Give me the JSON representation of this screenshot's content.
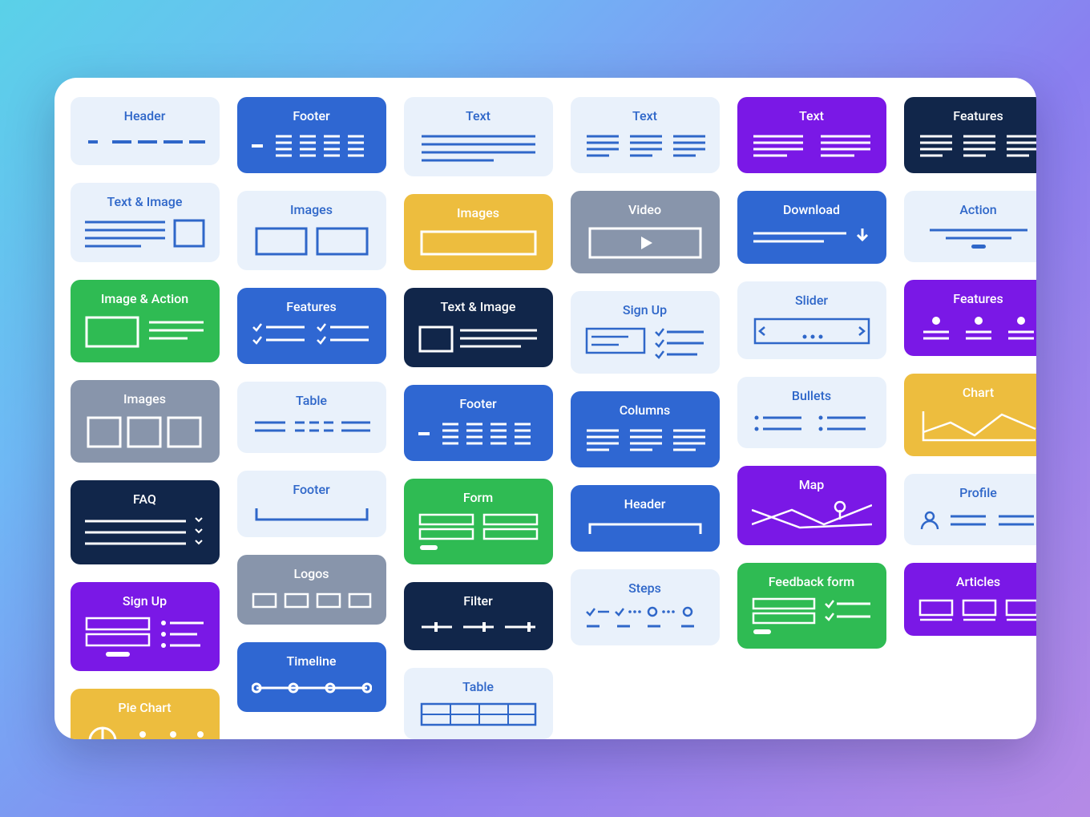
{
  "palette": {
    "light": {
      "bg": "#e9f1fb",
      "fg": "#2f67c9",
      "stroke": "#2f67c9"
    },
    "blue": {
      "bg": "#2f67d2",
      "fg": "#ffffff",
      "stroke": "#ffffff"
    },
    "navy": {
      "bg": "#11264a",
      "fg": "#ffffff",
      "stroke": "#ffffff"
    },
    "slate": {
      "bg": "#8895ab",
      "fg": "#ffffff",
      "stroke": "#ffffff"
    },
    "purple": {
      "bg": "#7a18e6",
      "fg": "#ffffff",
      "stroke": "#ffffff"
    },
    "green": {
      "bg": "#2fbb53",
      "fg": "#ffffff",
      "stroke": "#ffffff"
    },
    "yellow": {
      "bg": "#edbd3e",
      "fg": "#ffffff",
      "stroke": "#ffffff"
    }
  },
  "columns": [
    [
      {
        "id": "c1-header",
        "label": "Header",
        "theme": "light",
        "graphic": "header-dots"
      },
      {
        "id": "c1-text-image",
        "label": "Text & Image",
        "theme": "light",
        "graphic": "text-image"
      },
      {
        "id": "c1-image-action",
        "label": "Image & Action",
        "theme": "green",
        "graphic": "image-action"
      },
      {
        "id": "c1-images",
        "label": "Images",
        "theme": "slate",
        "graphic": "images-row3"
      },
      {
        "id": "c1-faq",
        "label": "FAQ",
        "theme": "navy",
        "graphic": "faq"
      },
      {
        "id": "c1-signup",
        "label": "Sign Up",
        "theme": "purple",
        "graphic": "signup-left"
      },
      {
        "id": "c1-piechart",
        "label": "Pie Chart",
        "theme": "yellow",
        "graphic": "piechart",
        "partial": true
      }
    ],
    [
      {
        "id": "c2-footer",
        "label": "Footer",
        "theme": "blue",
        "graphic": "footer-cols"
      },
      {
        "id": "c2-images",
        "label": "Images",
        "theme": "light",
        "graphic": "images-row2"
      },
      {
        "id": "c2-features",
        "label": "Features",
        "theme": "blue",
        "graphic": "features-checks"
      },
      {
        "id": "c2-table",
        "label": "Table",
        "theme": "light",
        "graphic": "table-lines"
      },
      {
        "id": "c2-footer2",
        "label": "Footer",
        "theme": "light",
        "graphic": "footer-bracket"
      },
      {
        "id": "c2-logos",
        "label": "Logos",
        "theme": "slate",
        "graphic": "logos"
      },
      {
        "id": "c2-timeline",
        "label": "Timeline",
        "theme": "blue",
        "graphic": "timeline",
        "partial": true
      }
    ],
    [
      {
        "id": "c3-text",
        "label": "Text",
        "theme": "light",
        "graphic": "text-block"
      },
      {
        "id": "c3-images",
        "label": "Images",
        "theme": "yellow",
        "graphic": "image-wide"
      },
      {
        "id": "c3-textimage",
        "label": "Text & Image",
        "theme": "navy",
        "graphic": "image-text"
      },
      {
        "id": "c3-footer",
        "label": "Footer",
        "theme": "blue",
        "graphic": "footer-cols"
      },
      {
        "id": "c3-form",
        "label": "Form",
        "theme": "green",
        "graphic": "form"
      },
      {
        "id": "c3-filter",
        "label": "Filter",
        "theme": "navy",
        "graphic": "filter"
      },
      {
        "id": "c3-table",
        "label": "Table",
        "theme": "light",
        "graphic": "table-grid",
        "partial": true
      }
    ],
    [
      {
        "id": "c4-text",
        "label": "Text",
        "theme": "light",
        "graphic": "text-3col"
      },
      {
        "id": "c4-video",
        "label": "Video",
        "theme": "slate",
        "graphic": "video"
      },
      {
        "id": "c4-signup",
        "label": "Sign Up",
        "theme": "light",
        "graphic": "signup-right"
      },
      {
        "id": "c4-columns",
        "label": "Columns",
        "theme": "blue",
        "graphic": "columns-3"
      },
      {
        "id": "c4-header",
        "label": "Header",
        "theme": "blue",
        "graphic": "header-bracket"
      },
      {
        "id": "c4-steps",
        "label": "Steps",
        "theme": "light",
        "graphic": "steps"
      }
    ],
    [
      {
        "id": "c5-text",
        "label": "Text",
        "theme": "purple",
        "graphic": "text-2col"
      },
      {
        "id": "c5-download",
        "label": "Download",
        "theme": "blue",
        "graphic": "download"
      },
      {
        "id": "c5-slider",
        "label": "Slider",
        "theme": "light",
        "graphic": "slider"
      },
      {
        "id": "c5-bullets",
        "label": "Bullets",
        "theme": "light",
        "graphic": "bullets"
      },
      {
        "id": "c5-map",
        "label": "Map",
        "theme": "purple",
        "graphic": "map"
      },
      {
        "id": "c5-feedback",
        "label": "Feedback form",
        "theme": "green",
        "graphic": "feedback"
      }
    ],
    [
      {
        "id": "c6-features",
        "label": "Features",
        "theme": "navy",
        "graphic": "features-bars"
      },
      {
        "id": "c6-action",
        "label": "Action",
        "theme": "light",
        "graphic": "action"
      },
      {
        "id": "c6-features2",
        "label": "Features",
        "theme": "purple",
        "graphic": "features-dots"
      },
      {
        "id": "c6-chart",
        "label": "Chart",
        "theme": "yellow",
        "graphic": "chart"
      },
      {
        "id": "c6-profile",
        "label": "Profile",
        "theme": "light",
        "graphic": "profile"
      },
      {
        "id": "c6-articles",
        "label": "Articles",
        "theme": "purple",
        "graphic": "articles"
      }
    ]
  ]
}
